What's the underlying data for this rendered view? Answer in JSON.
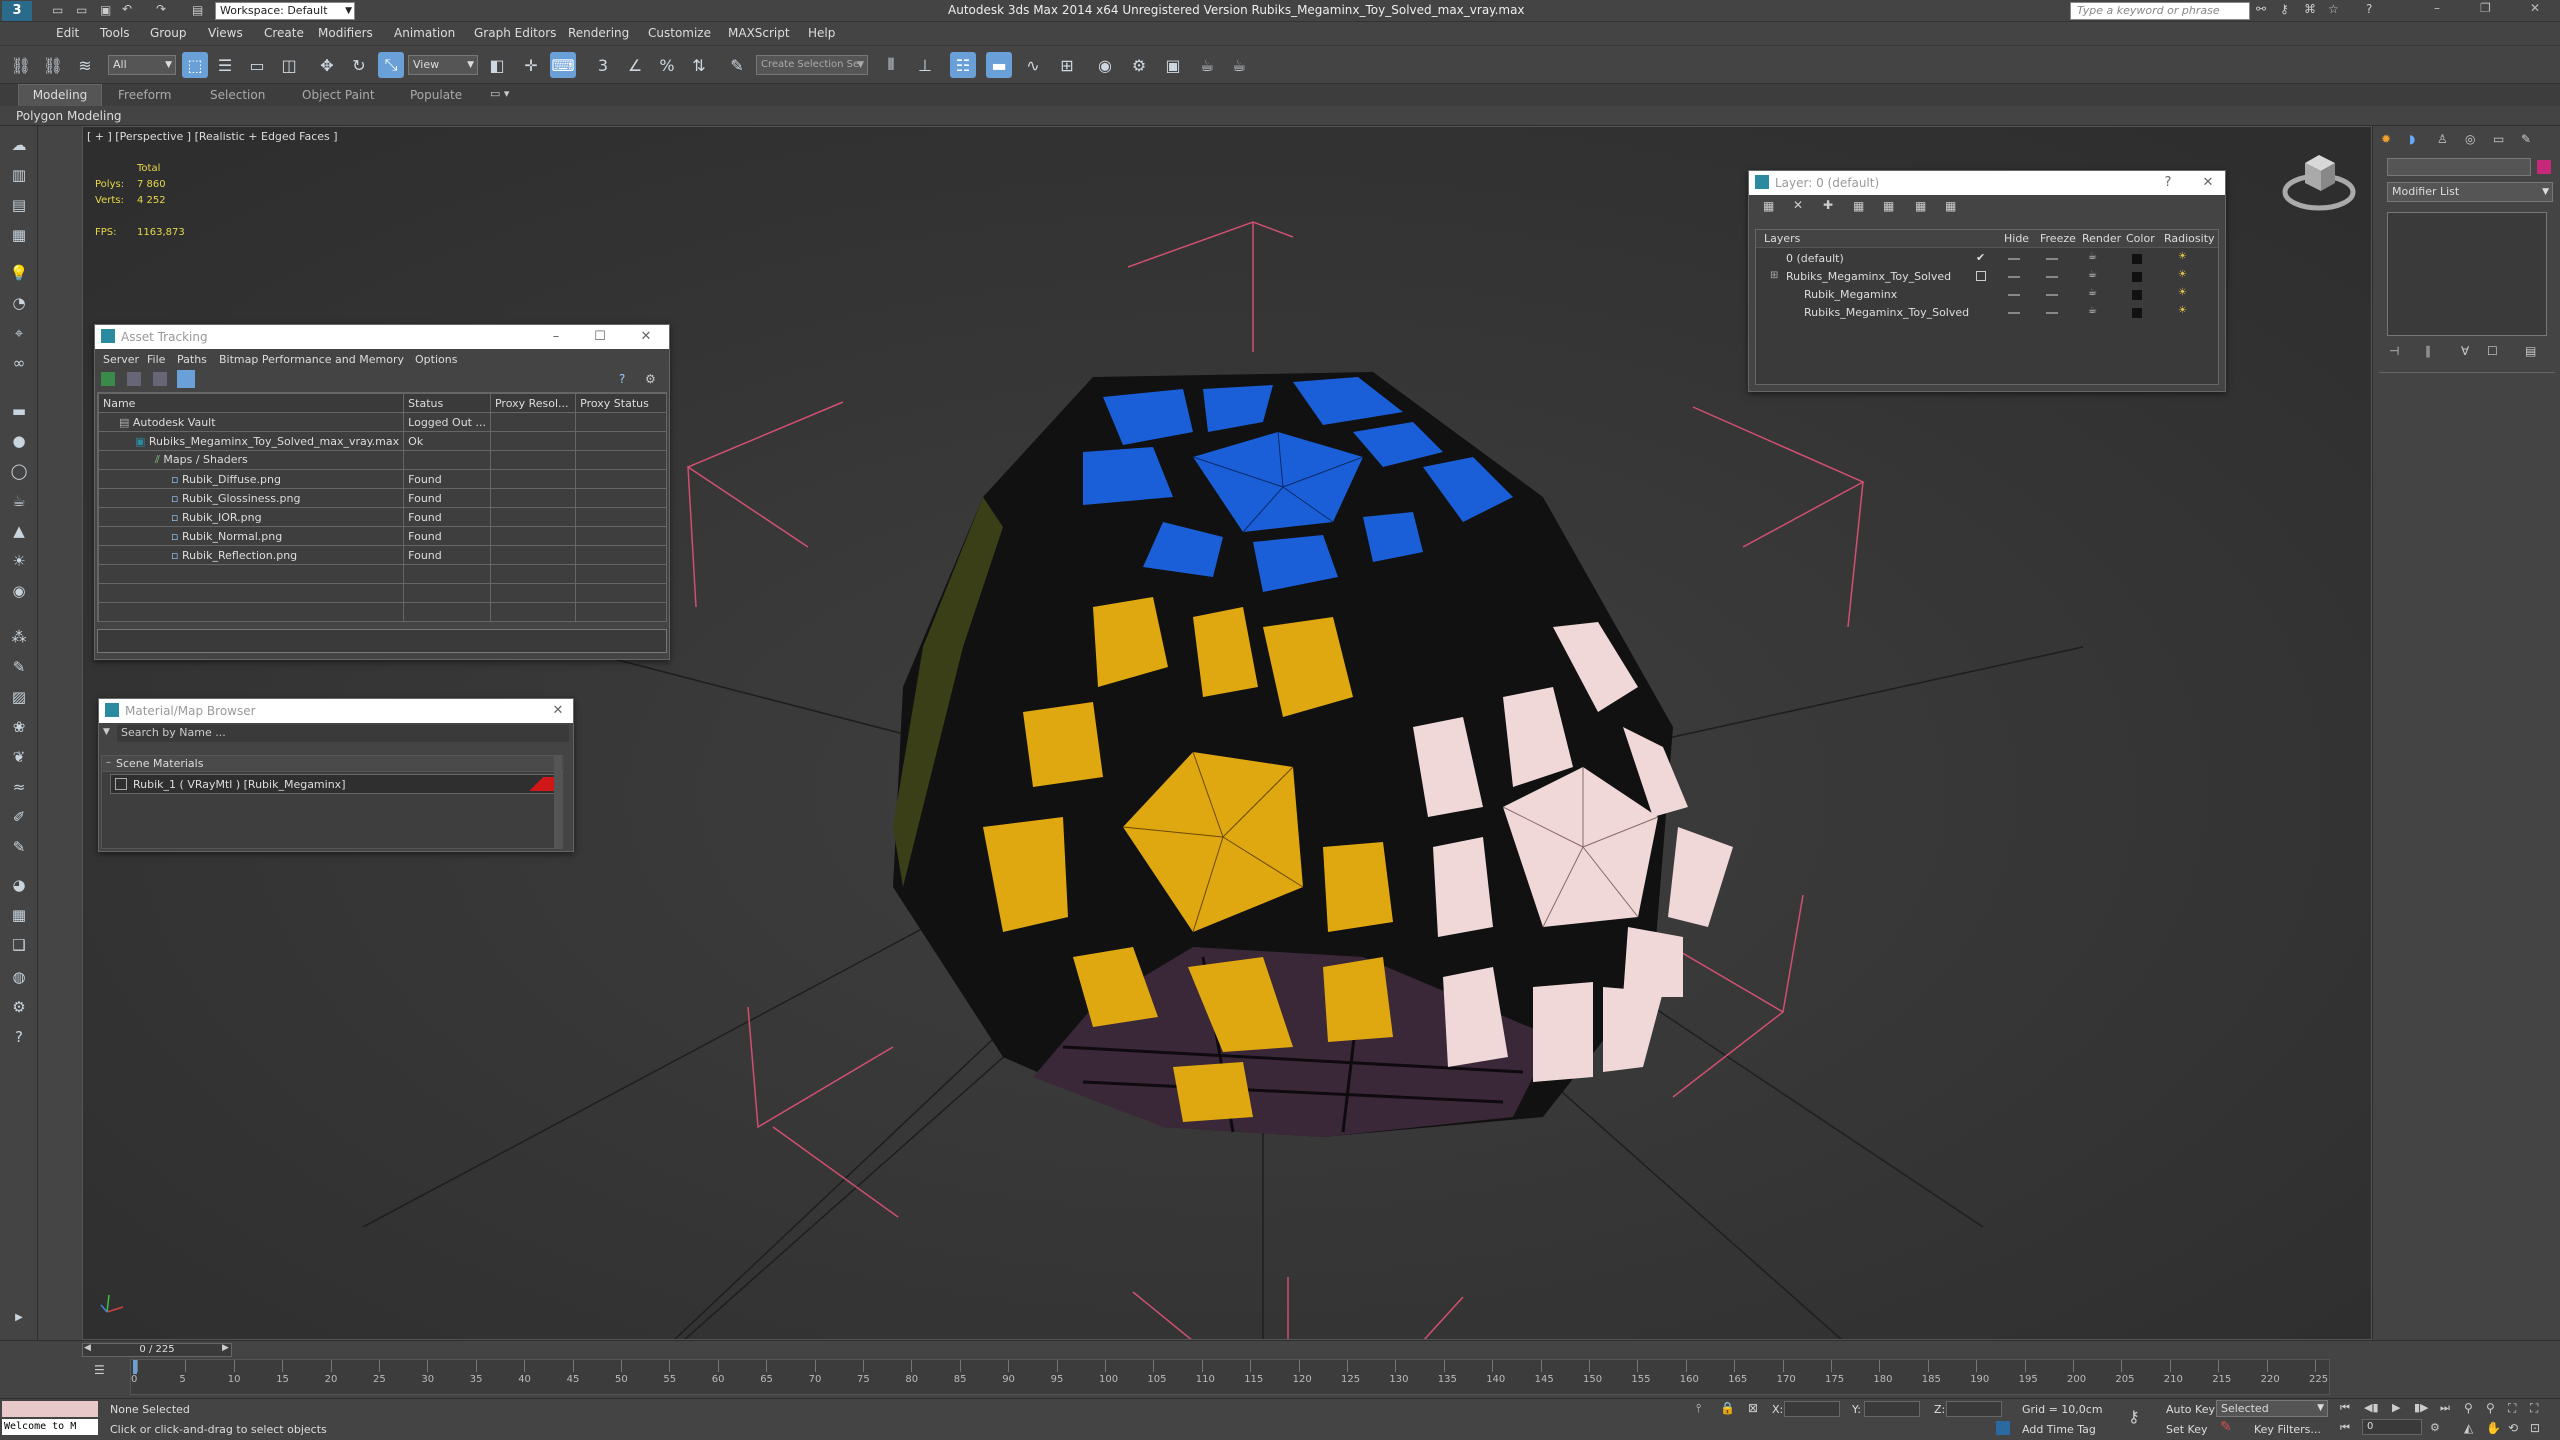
{
  "title_bar": {
    "workspace": "Workspace: Default",
    "window_title": "Autodesk 3ds Max  2014 x64    Unregistered Version    Rubiks_Megaminx_Toy_Solved_max_vray.max",
    "search_placeholder": "Type a keyword or phrase"
  },
  "menu": [
    "Edit",
    "Tools",
    "Group",
    "Views",
    "Create",
    "Modifiers",
    "Animation",
    "Graph Editors",
    "Rendering",
    "Customize",
    "MAXScript",
    "Help"
  ],
  "toolbar": {
    "filter_select": "All",
    "ref_coord_select": "View",
    "named_selection_placeholder": "Create Selection Se"
  },
  "ribbon": {
    "tabs": [
      "Modeling",
      "Freeform",
      "Selection",
      "Object Paint",
      "Populate"
    ],
    "sub_label": "Polygon Modeling"
  },
  "viewport": {
    "label": "[ + ] [Perspective ] [Realistic + Edged Faces ]",
    "stats_total": "Total",
    "polys_label": "Polys:",
    "polys_value": "7 860",
    "verts_label": "Verts:",
    "verts_value": "4 252",
    "fps_label": "FPS:",
    "fps_value": "1163,873"
  },
  "asset_tracking": {
    "title": "Asset Tracking",
    "menu": [
      "Server",
      "File",
      "Paths",
      "Bitmap Performance and Memory",
      "Options"
    ],
    "columns": [
      "Name",
      "Status",
      "Proxy Resol...",
      "Proxy Status"
    ],
    "rows": [
      {
        "name": "Autodesk Vault",
        "status": "Logged Out ..."
      },
      {
        "name": "Rubiks_Megaminx_Toy_Solved_max_vray.max",
        "status": "Ok"
      },
      {
        "name": "Maps / Shaders",
        "status": ""
      },
      {
        "name": "Rubik_Diffuse.png",
        "status": "Found"
      },
      {
        "name": "Rubik_Glossiness.png",
        "status": "Found"
      },
      {
        "name": "Rubik_IOR.png",
        "status": "Found"
      },
      {
        "name": "Rubik_Normal.png",
        "status": "Found"
      },
      {
        "name": "Rubik_Reflection.png",
        "status": "Found"
      }
    ]
  },
  "material_browser": {
    "title": "Material/Map Browser",
    "search_placeholder": "Search by Name ...",
    "group": "Scene Materials",
    "item": "Rubik_1  ( VRayMtl )  [Rubik_Megaminx]"
  },
  "layer_dialog": {
    "title": "Layer: 0 (default)",
    "columns": [
      "Layers",
      "Hide",
      "Freeze",
      "Render",
      "Color",
      "Radiosity"
    ],
    "rows": [
      {
        "name": "0 (default)",
        "indent": 0
      },
      {
        "name": "Rubiks_Megaminx_Toy_Solved",
        "indent": 0
      },
      {
        "name": "Rubik_Megaminx",
        "indent": 1
      },
      {
        "name": "Rubiks_Megaminx_Toy_Solved",
        "indent": 1
      }
    ]
  },
  "command_panel": {
    "modifier_list": "Modifier List"
  },
  "timeline": {
    "frame_counter": "0 / 225",
    "ticks": [
      "0",
      "5",
      "10",
      "15",
      "20",
      "25",
      "30",
      "35",
      "40",
      "45",
      "50",
      "55",
      "60",
      "65",
      "70",
      "75",
      "80",
      "85",
      "90",
      "95",
      "100",
      "105",
      "110",
      "115",
      "120",
      "125",
      "130",
      "135",
      "140",
      "145",
      "150",
      "155",
      "160",
      "165",
      "170",
      "175",
      "180",
      "185",
      "190",
      "195",
      "200",
      "205",
      "210",
      "215",
      "220",
      "225"
    ]
  },
  "status": {
    "maxscript": "Welcome to M",
    "selection": "None Selected",
    "prompt": "Click or click-and-drag to select objects",
    "x_label": "X:",
    "y_label": "Y:",
    "z_label": "Z:",
    "grid": "Grid = 10,0cm",
    "add_time_tag": "Add Time Tag",
    "auto_key": "Auto Key",
    "auto_key_select": "Selected",
    "set_key": "Set Key",
    "key_filters": "Key Filters...",
    "frame_input": "0"
  },
  "colors": {
    "face_blue": "#1a5fd8",
    "face_yellow": "#e0a810",
    "face_white": "#f0d8d8",
    "face_purple": "#3a2838",
    "gizmo_pink": "#d05070"
  }
}
